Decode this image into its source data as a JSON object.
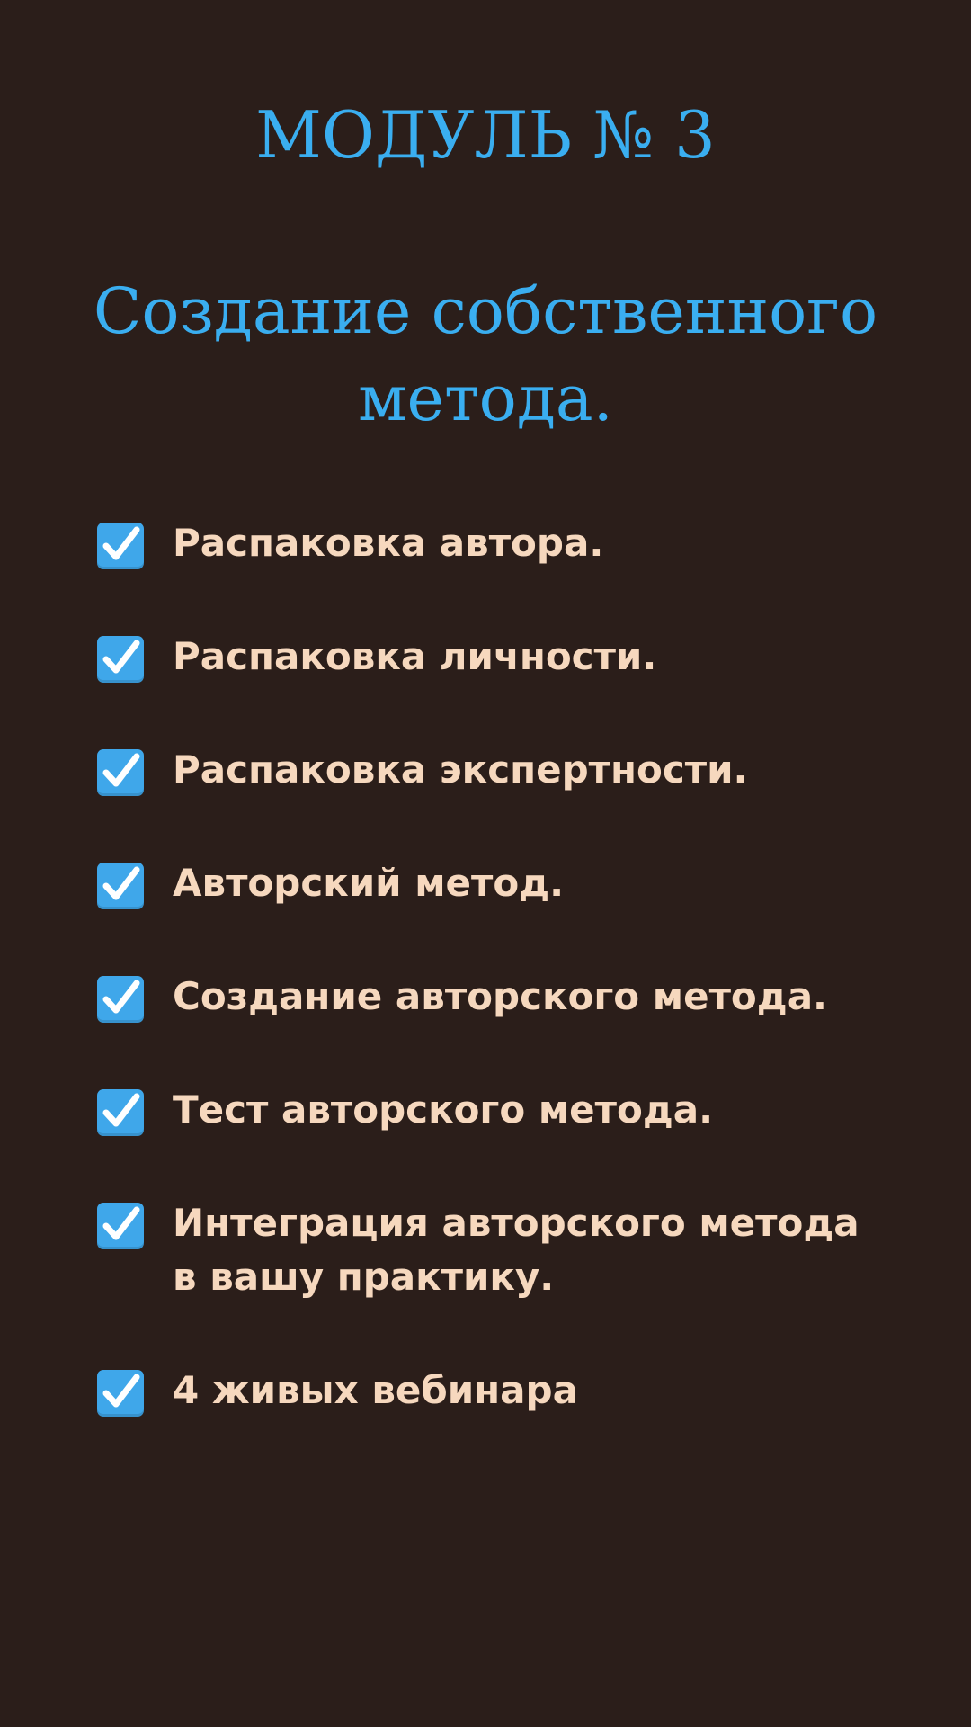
{
  "module": {
    "title": "МОДУЛЬ № 3"
  },
  "section": {
    "title": "Создание собственного метода."
  },
  "checklist": {
    "icon": "check-mark-button-icon",
    "accent_color": "#3aaef0",
    "text_color": "#f6d8be",
    "items": [
      {
        "label": "Распаковка автора."
      },
      {
        "label": "Распаковка личности."
      },
      {
        "label": "Распаковка экспертности."
      },
      {
        "label": "Авторский метод."
      },
      {
        "label": "Создание авторского метода."
      },
      {
        "label": "Тест авторского метода."
      },
      {
        "label": "Интеграция авторского метода в вашу практику."
      },
      {
        "label": "4 живых вебинара"
      }
    ]
  }
}
